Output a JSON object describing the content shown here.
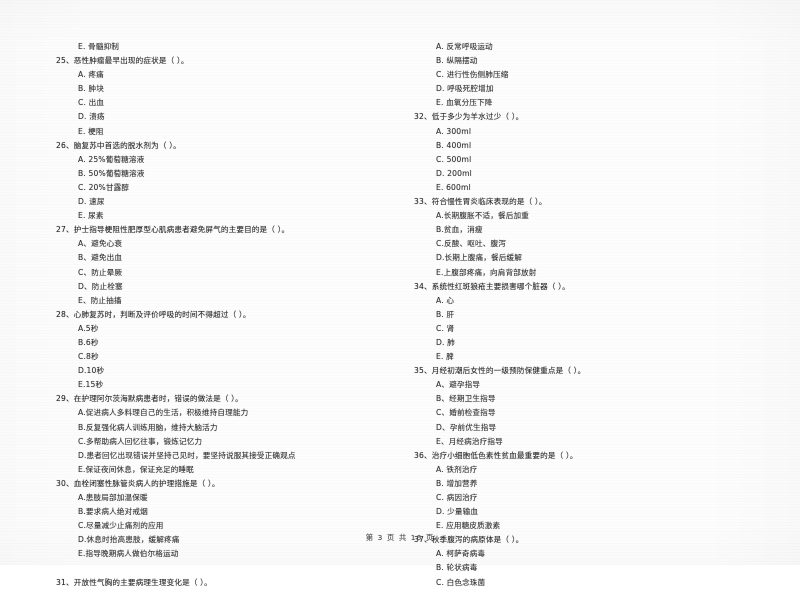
{
  "document": {
    "type": "scanned-exam-paper",
    "language": "zh-CN",
    "footer": "第 3 页 共 16 页"
  },
  "left_column": [
    {
      "kind": "option",
      "text": "E. 骨髓抑制"
    },
    {
      "kind": "question",
      "text": "25、恶性肿瘤最早出现的症状是（     ）。"
    },
    {
      "kind": "option",
      "text": "A.  疼痛"
    },
    {
      "kind": "option",
      "text": "B.  肿块"
    },
    {
      "kind": "option",
      "text": "C.  出血"
    },
    {
      "kind": "option",
      "text": "D.  溃疡"
    },
    {
      "kind": "option",
      "text": "E.  梗阻"
    },
    {
      "kind": "question",
      "text": "26、脑复苏中首选的脱水剂为（     ）。"
    },
    {
      "kind": "option",
      "text": "A.  25%葡萄糖溶液"
    },
    {
      "kind": "option",
      "text": "B.  50%葡萄糖溶液"
    },
    {
      "kind": "option",
      "text": "C.  20%甘露醇"
    },
    {
      "kind": "option",
      "text": "D.  速尿"
    },
    {
      "kind": "option",
      "text": "E.  尿素"
    },
    {
      "kind": "question",
      "text": "27、护士指导梗阻性肥厚型心肌病患者避免屏气的主要目的是（     ）。"
    },
    {
      "kind": "option",
      "text": "A、避免心衰"
    },
    {
      "kind": "option",
      "text": "B、避免出血"
    },
    {
      "kind": "option",
      "text": "C、防止晕厥"
    },
    {
      "kind": "option",
      "text": "D、防止栓塞"
    },
    {
      "kind": "option",
      "text": "E、防止抽搐"
    },
    {
      "kind": "question",
      "text": "28、心肺复苏时，判断及评价呼吸的时间不得超过（     ）。"
    },
    {
      "kind": "option",
      "text": "A.5秒"
    },
    {
      "kind": "option",
      "text": "B.6秒"
    },
    {
      "kind": "option",
      "text": "C.8秒"
    },
    {
      "kind": "option",
      "text": "D.10秒"
    },
    {
      "kind": "option",
      "text": "E.15秒"
    },
    {
      "kind": "question",
      "text": "29、在护理阿尔茨海默病患者时，错误的做法是（     ）。"
    },
    {
      "kind": "option",
      "text": "A.促进病人多料理自己的生活，积极维持自理能力"
    },
    {
      "kind": "option",
      "text": "B.反复强化病人训练用脑，维持大脑活力"
    },
    {
      "kind": "option",
      "text": "C.多帮助病人回忆往事，锻炼记忆力"
    },
    {
      "kind": "option",
      "text": "D.患者回忆出现错误并坚持己见时，要坚持说服其接受正确观点"
    },
    {
      "kind": "option",
      "text": "E.保证夜间休息，保证充足的睡眠"
    },
    {
      "kind": "question",
      "text": "30、血栓闭塞性脉管炎病人的护理措施是（     ）。"
    },
    {
      "kind": "option",
      "text": "A.患肢局部加温保暖"
    },
    {
      "kind": "option",
      "text": "B.要求病人绝对戒烟"
    },
    {
      "kind": "option",
      "text": "C.尽量减少止痛剂的应用"
    },
    {
      "kind": "option",
      "text": "D.休息时抬高患肢，缓解疼痛"
    },
    {
      "kind": "option",
      "text": "E.指导晚期病人做伯尔格运动"
    },
    {
      "kind": "spacer",
      "text": ""
    },
    {
      "kind": "question",
      "text": "31、开放性气胸的主要病理生理变化是（     ）。"
    }
  ],
  "right_column": [
    {
      "kind": "option",
      "text": "A.  反常呼吸运动"
    },
    {
      "kind": "option",
      "text": "B.  纵隔摆动"
    },
    {
      "kind": "option",
      "text": "C.  进行性伤侧肺压缩"
    },
    {
      "kind": "option",
      "text": "D.  呼吸死腔增加"
    },
    {
      "kind": "option",
      "text": "E.  血氧分压下降"
    },
    {
      "kind": "question",
      "text": "32、低于多少为羊水过少（     ）。"
    },
    {
      "kind": "option",
      "text": "A.  300ml"
    },
    {
      "kind": "option",
      "text": "B.  400ml"
    },
    {
      "kind": "option",
      "text": "C.  500ml"
    },
    {
      "kind": "option",
      "text": "D.  200ml"
    },
    {
      "kind": "option",
      "text": "E.  600ml"
    },
    {
      "kind": "question",
      "text": "33、符合慢性胃炎临床表现的是（     ）。"
    },
    {
      "kind": "option",
      "text": "A.长期腹胀不适，餐后加重"
    },
    {
      "kind": "option",
      "text": "B.贫血，消瘦"
    },
    {
      "kind": "option",
      "text": "C.反酸、呕吐、腹泻"
    },
    {
      "kind": "option",
      "text": "D.长期上腹痛，餐后缓解"
    },
    {
      "kind": "option",
      "text": "E.上腹部疼痛，向肩背部放射"
    },
    {
      "kind": "question",
      "text": "34、系统性红斑狼疮主要损害哪个脏器（     ）。"
    },
    {
      "kind": "option",
      "text": "A.  心"
    },
    {
      "kind": "option",
      "text": "B.  肝"
    },
    {
      "kind": "option",
      "text": "C.  肾"
    },
    {
      "kind": "option",
      "text": "D.  肺"
    },
    {
      "kind": "option",
      "text": "E.  脾"
    },
    {
      "kind": "question",
      "text": "35、月经初潮后女性的一级预防保健重点是（     ）。"
    },
    {
      "kind": "option",
      "text": "A、避孕指导"
    },
    {
      "kind": "option",
      "text": "B、经期卫生指导"
    },
    {
      "kind": "option",
      "text": "C、婚前检查指导"
    },
    {
      "kind": "option",
      "text": "D、孕前优生指导"
    },
    {
      "kind": "option",
      "text": "E、月经病治疗指导"
    },
    {
      "kind": "question",
      "text": "36、治疗小细胞低色素性贫血最重要的是（     ）。"
    },
    {
      "kind": "option",
      "text": "A.  铁剂治疗"
    },
    {
      "kind": "option",
      "text": "B.  增加营养"
    },
    {
      "kind": "option",
      "text": "C.  病因治疗"
    },
    {
      "kind": "option",
      "text": "D.  少量输血"
    },
    {
      "kind": "option",
      "text": "E.  应用糖皮质激素"
    },
    {
      "kind": "question",
      "text": "37、秋季腹泻的病原体是（     ）。"
    },
    {
      "kind": "option",
      "text": "A.  柯萨奇病毒"
    },
    {
      "kind": "option",
      "text": "B.  轮状病毒"
    },
    {
      "kind": "option",
      "text": "C.  白色念珠菌"
    }
  ]
}
